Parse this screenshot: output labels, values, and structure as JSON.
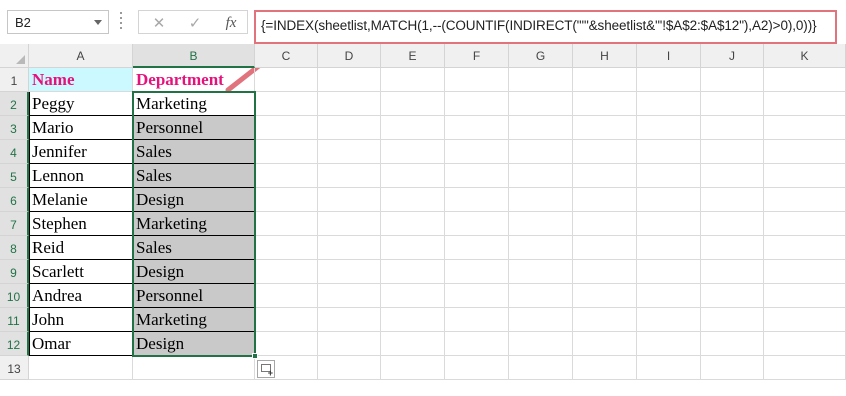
{
  "namebox": {
    "value": "B2"
  },
  "formula_buttons": {
    "cancel": "✕",
    "enter": "✓",
    "fx": "fx"
  },
  "formula": {
    "text": "{=INDEX(sheetlist,MATCH(1,--(COUNTIF(INDIRECT(\"'\"&sheetlist&\"'!$A$2:$A$12\"),A2)>0),0))}"
  },
  "columns": [
    "A",
    "B",
    "C",
    "D",
    "E",
    "F",
    "G",
    "H",
    "I",
    "J",
    "K"
  ],
  "rows": [
    "1",
    "2",
    "3",
    "4",
    "5",
    "6",
    "7",
    "8",
    "9",
    "10",
    "11",
    "12",
    "13"
  ],
  "headers": {
    "a": "Name",
    "b": "Department"
  },
  "data": [
    {
      "name": "Peggy",
      "dept": "Marketing"
    },
    {
      "name": "Mario",
      "dept": "Personnel"
    },
    {
      "name": "Jennifer",
      "dept": "Sales"
    },
    {
      "name": "Lennon",
      "dept": "Sales"
    },
    {
      "name": "Melanie",
      "dept": "Design"
    },
    {
      "name": "Stephen",
      "dept": "Marketing"
    },
    {
      "name": "Reid",
      "dept": "Sales"
    },
    {
      "name": "Scarlett",
      "dept": "Design"
    },
    {
      "name": "Andrea",
      "dept": "Personnel"
    },
    {
      "name": "John",
      "dept": "Marketing"
    },
    {
      "name": "Omar",
      "dept": "Design"
    }
  ],
  "colors": {
    "header_text": "#e6127c",
    "header_fill_a": "#ccf8ff",
    "selection": "#217346",
    "callout": "#e0737c"
  }
}
